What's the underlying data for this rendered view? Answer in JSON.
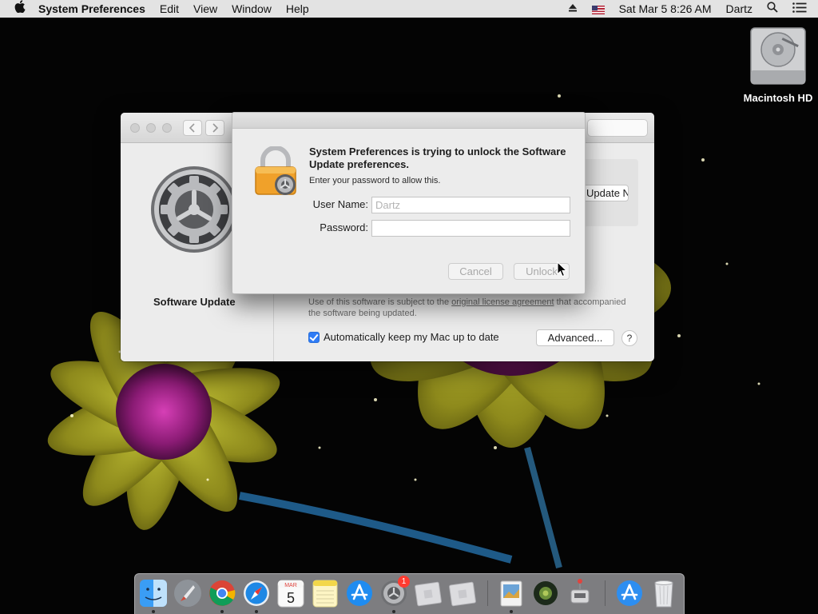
{
  "menubar": {
    "apple_icon": "apple-icon",
    "app_name": "System Preferences",
    "menus": [
      "Edit",
      "View",
      "Window",
      "Help"
    ],
    "clock": "Sat Mar 5  8:26 AM",
    "user": "Dartz",
    "icons": [
      "eject-icon",
      "us-flag-icon",
      "spotlight-search-icon",
      "notification-center-icon"
    ]
  },
  "desktop": {
    "hd_label": "Macintosh HD"
  },
  "prefs_window": {
    "sidebar_title": "Software Update",
    "update_button": "Update Now",
    "license_text_before": "Use of this software is subject to the ",
    "license_link": "original license agreement",
    "license_text_after": " that accompanied the software being updated.",
    "auto_update_label": "Automatically keep my Mac up to date",
    "auto_update_checked": true,
    "advanced_button": "Advanced...",
    "help_button": "?"
  },
  "unlock_dialog": {
    "heading": "System Preferences is trying to unlock the Software Update preferences.",
    "subtext": "Enter your password to allow this.",
    "username_label": "User Name:",
    "username_value": "Dartz",
    "password_label": "Password:",
    "password_value": "",
    "cancel_button": "Cancel",
    "unlock_button": "Unlock"
  },
  "dock": {
    "calendar_month": "MAR",
    "calendar_day": "5",
    "system_prefs_badge": "1",
    "items": [
      "finder-icon",
      "launchpad-icon",
      "chrome-icon",
      "safari-icon",
      "calendar-icon",
      "notes-icon",
      "app-store-icon",
      "system-preferences-icon",
      "window-thumb-icon",
      "window-thumb-icon",
      "preview-icon",
      "photo-icon",
      "utility-icon",
      "downloads-icon",
      "trash-icon"
    ]
  }
}
